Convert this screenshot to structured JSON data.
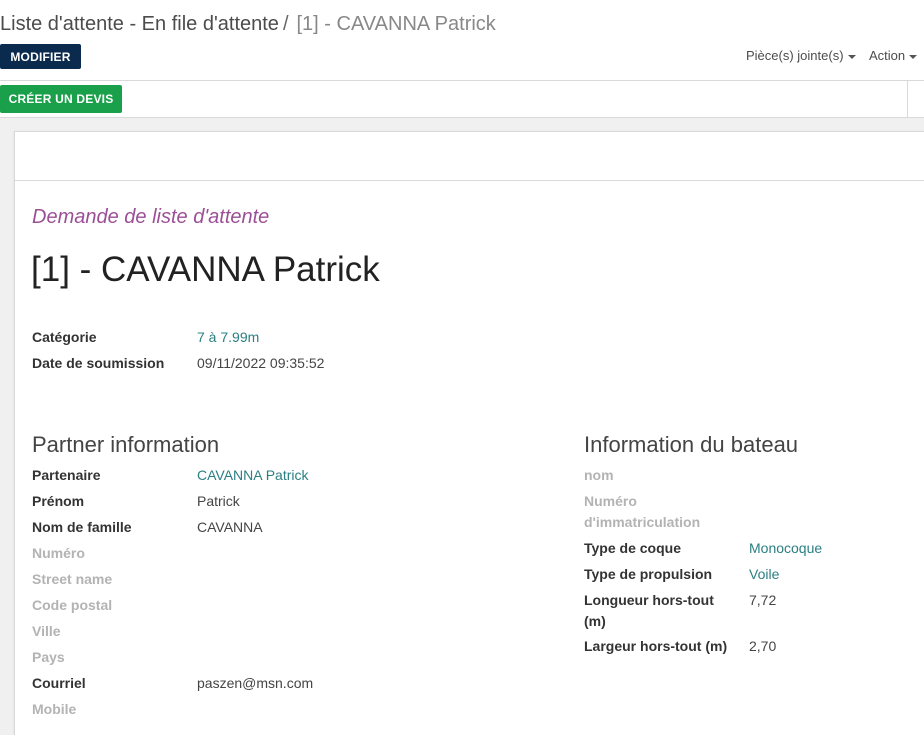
{
  "breadcrumb": {
    "parent": "Liste d'attente - En file d'attente",
    "separator": "/",
    "current": "[1] - CAVANNA Patrick"
  },
  "toolbar": {
    "edit_label": "MODIFIER",
    "attachments_label": "Pièce(s) jointe(s)",
    "action_label": "Action"
  },
  "statusbar": {
    "create_quote_label": "CRÉER UN DEVIS"
  },
  "form": {
    "subtitle": "Demande de liste d'attente",
    "title": "[1] - CAVANNA Patrick",
    "top_fields": [
      {
        "label": "Catégorie",
        "value": "7 à 7.99m"
      },
      {
        "label": "Date de soumission",
        "value": "09/11/2022 09:35:52"
      }
    ],
    "partner_section": {
      "title": "Partner information",
      "fields": [
        {
          "label": "Partenaire",
          "value": "CAVANNA Patrick"
        },
        {
          "label": "Prénom",
          "value": "Patrick"
        },
        {
          "label": "Nom de famille",
          "value": "CAVANNA"
        },
        {
          "label": "Numéro",
          "value": ""
        },
        {
          "label": "Street name",
          "value": ""
        },
        {
          "label": "Code postal",
          "value": ""
        },
        {
          "label": "Ville",
          "value": ""
        },
        {
          "label": "Pays",
          "value": ""
        },
        {
          "label": "Courriel",
          "value": "paszen@msn.com"
        },
        {
          "label": "Mobile",
          "value": ""
        }
      ]
    },
    "boat_section": {
      "title": "Information du bateau",
      "fields": [
        {
          "label": "nom",
          "value": ""
        },
        {
          "label_line1": "Numéro",
          "label_line2": "d'immatriculation",
          "value": ""
        },
        {
          "label": "Type de coque",
          "value": "Monocoque"
        },
        {
          "label": "Type de propulsion",
          "value": "Voile"
        },
        {
          "label_line1": "Longueur hors-tout",
          "label_line2": "(m)",
          "value": "7,72"
        },
        {
          "label": "Largeur hors-tout (m)",
          "value": "2,70"
        }
      ]
    }
  },
  "colors": {
    "edit_button": "#0b2b4e",
    "create_quote_button": "#1aa04a",
    "subtitle": "#9b4f96",
    "link": "#2b7f82"
  }
}
